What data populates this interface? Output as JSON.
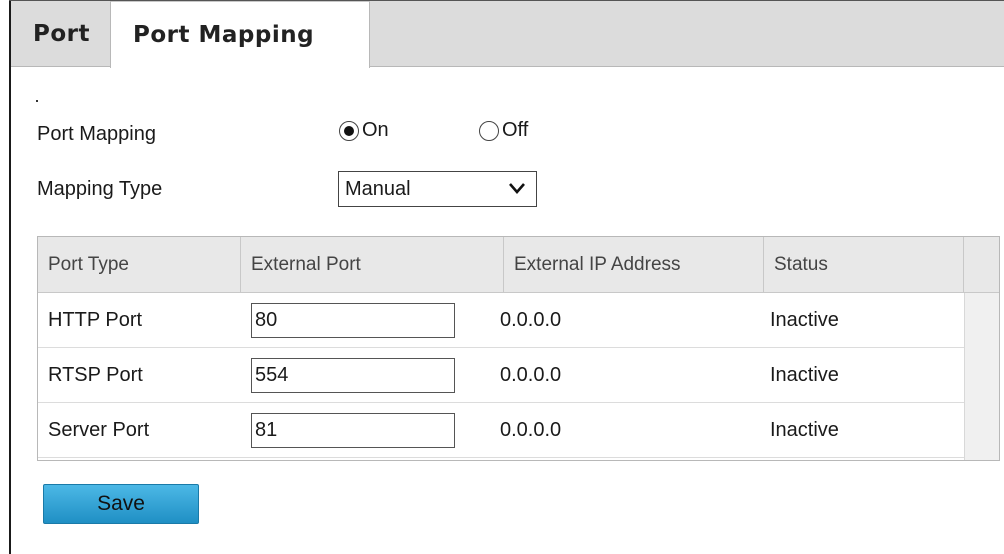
{
  "tabs": [
    {
      "label": "Port",
      "active": false
    },
    {
      "label": "Port Mapping",
      "active": true
    }
  ],
  "form": {
    "port_mapping_label": "Port Mapping",
    "radio_on_label": "On",
    "radio_off_label": "Off",
    "selected": "On",
    "mapping_type_label": "Mapping Type",
    "mapping_type_value": "Manual"
  },
  "table": {
    "headers": [
      "Port Type",
      "External Port",
      "External IP Address",
      "Status"
    ],
    "rows": [
      {
        "port_type": "HTTP Port",
        "external_port": "80",
        "external_ip": "0.0.0.0",
        "status": "Inactive"
      },
      {
        "port_type": "RTSP Port",
        "external_port": "554",
        "external_ip": "0.0.0.0",
        "status": "Inactive"
      },
      {
        "port_type": "Server Port",
        "external_port": "81",
        "external_ip": "0.0.0.0",
        "status": "Inactive"
      }
    ]
  },
  "save_label": "Save",
  "icons": {
    "select_chevron": "chevron-down-icon",
    "radio": "radio-icon"
  },
  "colors": {
    "save_button": "#2a9fd6",
    "tab_strip": "#dcdcdc",
    "table_header": "#e8e8e8"
  }
}
